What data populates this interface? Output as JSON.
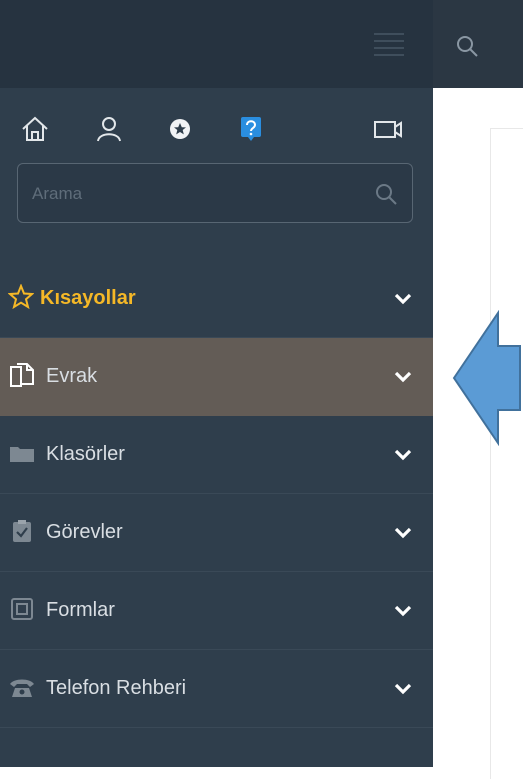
{
  "search": {
    "placeholder": "Arama"
  },
  "toolbar": {
    "icons": [
      "home-icon",
      "user-icon",
      "star-circle-icon",
      "help-icon",
      "video-camera-icon"
    ]
  },
  "menu": {
    "items": [
      {
        "label": "Kısayollar",
        "icon": "star-outline-icon",
        "color": "#f5b827"
      },
      {
        "label": "Evrak",
        "icon": "documents-icon",
        "active": true
      },
      {
        "label": "Klasörler",
        "icon": "folder-icon"
      },
      {
        "label": "Görevler",
        "icon": "clipboard-check-icon"
      },
      {
        "label": "Formlar",
        "icon": "form-icon"
      },
      {
        "label": "Telefon Rehberi",
        "icon": "telephone-icon"
      }
    ]
  },
  "colors": {
    "sidebar": "#2f3e4c",
    "active_item": "#635c56",
    "accent": "#f5b827",
    "arrow": "#5b9bd5"
  }
}
